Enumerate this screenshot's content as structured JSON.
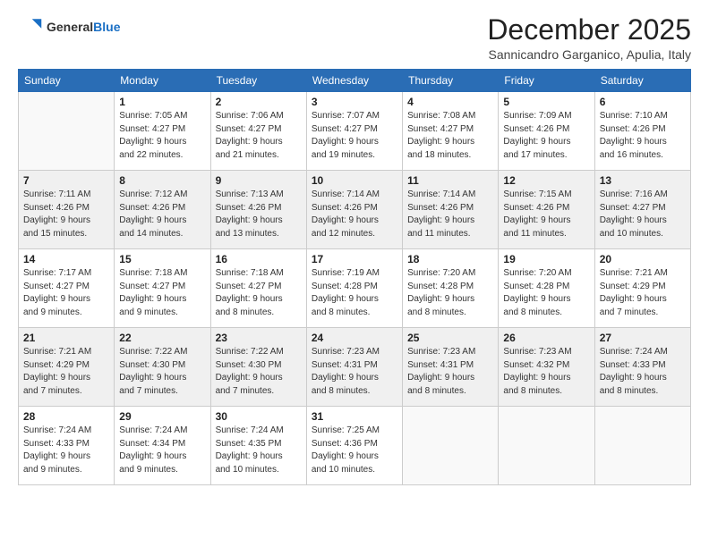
{
  "logo": {
    "general": "General",
    "blue": "Blue"
  },
  "header": {
    "month": "December 2025",
    "location": "Sannicandro Garganico, Apulia, Italy"
  },
  "days_of_week": [
    "Sunday",
    "Monday",
    "Tuesday",
    "Wednesday",
    "Thursday",
    "Friday",
    "Saturday"
  ],
  "weeks": [
    [
      {
        "day": "",
        "info": ""
      },
      {
        "day": "1",
        "info": "Sunrise: 7:05 AM\nSunset: 4:27 PM\nDaylight: 9 hours\nand 22 minutes."
      },
      {
        "day": "2",
        "info": "Sunrise: 7:06 AM\nSunset: 4:27 PM\nDaylight: 9 hours\nand 21 minutes."
      },
      {
        "day": "3",
        "info": "Sunrise: 7:07 AM\nSunset: 4:27 PM\nDaylight: 9 hours\nand 19 minutes."
      },
      {
        "day": "4",
        "info": "Sunrise: 7:08 AM\nSunset: 4:27 PM\nDaylight: 9 hours\nand 18 minutes."
      },
      {
        "day": "5",
        "info": "Sunrise: 7:09 AM\nSunset: 4:26 PM\nDaylight: 9 hours\nand 17 minutes."
      },
      {
        "day": "6",
        "info": "Sunrise: 7:10 AM\nSunset: 4:26 PM\nDaylight: 9 hours\nand 16 minutes."
      }
    ],
    [
      {
        "day": "7",
        "info": "Sunrise: 7:11 AM\nSunset: 4:26 PM\nDaylight: 9 hours\nand 15 minutes."
      },
      {
        "day": "8",
        "info": "Sunrise: 7:12 AM\nSunset: 4:26 PM\nDaylight: 9 hours\nand 14 minutes."
      },
      {
        "day": "9",
        "info": "Sunrise: 7:13 AM\nSunset: 4:26 PM\nDaylight: 9 hours\nand 13 minutes."
      },
      {
        "day": "10",
        "info": "Sunrise: 7:14 AM\nSunset: 4:26 PM\nDaylight: 9 hours\nand 12 minutes."
      },
      {
        "day": "11",
        "info": "Sunrise: 7:14 AM\nSunset: 4:26 PM\nDaylight: 9 hours\nand 11 minutes."
      },
      {
        "day": "12",
        "info": "Sunrise: 7:15 AM\nSunset: 4:26 PM\nDaylight: 9 hours\nand 11 minutes."
      },
      {
        "day": "13",
        "info": "Sunrise: 7:16 AM\nSunset: 4:27 PM\nDaylight: 9 hours\nand 10 minutes."
      }
    ],
    [
      {
        "day": "14",
        "info": "Sunrise: 7:17 AM\nSunset: 4:27 PM\nDaylight: 9 hours\nand 9 minutes."
      },
      {
        "day": "15",
        "info": "Sunrise: 7:18 AM\nSunset: 4:27 PM\nDaylight: 9 hours\nand 9 minutes."
      },
      {
        "day": "16",
        "info": "Sunrise: 7:18 AM\nSunset: 4:27 PM\nDaylight: 9 hours\nand 8 minutes."
      },
      {
        "day": "17",
        "info": "Sunrise: 7:19 AM\nSunset: 4:28 PM\nDaylight: 9 hours\nand 8 minutes."
      },
      {
        "day": "18",
        "info": "Sunrise: 7:20 AM\nSunset: 4:28 PM\nDaylight: 9 hours\nand 8 minutes."
      },
      {
        "day": "19",
        "info": "Sunrise: 7:20 AM\nSunset: 4:28 PM\nDaylight: 9 hours\nand 8 minutes."
      },
      {
        "day": "20",
        "info": "Sunrise: 7:21 AM\nSunset: 4:29 PM\nDaylight: 9 hours\nand 7 minutes."
      }
    ],
    [
      {
        "day": "21",
        "info": "Sunrise: 7:21 AM\nSunset: 4:29 PM\nDaylight: 9 hours\nand 7 minutes."
      },
      {
        "day": "22",
        "info": "Sunrise: 7:22 AM\nSunset: 4:30 PM\nDaylight: 9 hours\nand 7 minutes."
      },
      {
        "day": "23",
        "info": "Sunrise: 7:22 AM\nSunset: 4:30 PM\nDaylight: 9 hours\nand 7 minutes."
      },
      {
        "day": "24",
        "info": "Sunrise: 7:23 AM\nSunset: 4:31 PM\nDaylight: 9 hours\nand 8 minutes."
      },
      {
        "day": "25",
        "info": "Sunrise: 7:23 AM\nSunset: 4:31 PM\nDaylight: 9 hours\nand 8 minutes."
      },
      {
        "day": "26",
        "info": "Sunrise: 7:23 AM\nSunset: 4:32 PM\nDaylight: 9 hours\nand 8 minutes."
      },
      {
        "day": "27",
        "info": "Sunrise: 7:24 AM\nSunset: 4:33 PM\nDaylight: 9 hours\nand 8 minutes."
      }
    ],
    [
      {
        "day": "28",
        "info": "Sunrise: 7:24 AM\nSunset: 4:33 PM\nDaylight: 9 hours\nand 9 minutes."
      },
      {
        "day": "29",
        "info": "Sunrise: 7:24 AM\nSunset: 4:34 PM\nDaylight: 9 hours\nand 9 minutes."
      },
      {
        "day": "30",
        "info": "Sunrise: 7:24 AM\nSunset: 4:35 PM\nDaylight: 9 hours\nand 10 minutes."
      },
      {
        "day": "31",
        "info": "Sunrise: 7:25 AM\nSunset: 4:36 PM\nDaylight: 9 hours\nand 10 minutes."
      },
      {
        "day": "",
        "info": ""
      },
      {
        "day": "",
        "info": ""
      },
      {
        "day": "",
        "info": ""
      }
    ]
  ]
}
